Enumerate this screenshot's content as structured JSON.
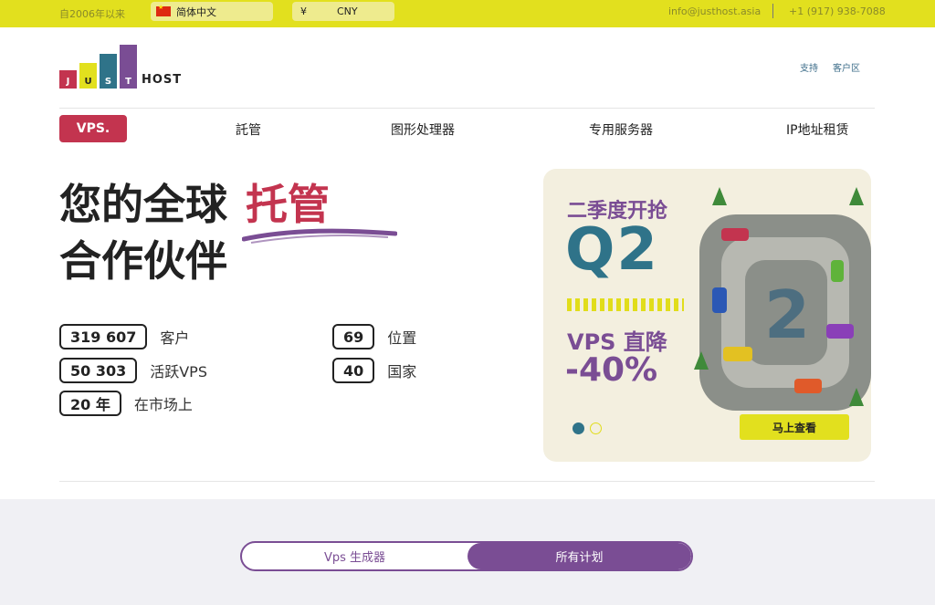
{
  "topbar": {
    "since": "自2006年以来",
    "language": "简体中文",
    "currency_symbol": "¥",
    "currency": "CNY",
    "email": "info@justhost.asia",
    "phone": "+1 (917) 938-7088",
    "background_color": "#e2e01e"
  },
  "logo": {
    "letters": [
      "J",
      "U",
      "S",
      "T"
    ],
    "text": "HOST",
    "bar_colors": [
      "#c3344f",
      "#e2e01e",
      "#2f7389",
      "#7a4d94"
    ]
  },
  "header_links": {
    "support": "支持",
    "client_area": "客户区"
  },
  "nav": {
    "active": "VPS.",
    "items": [
      "託管",
      "图形处理器",
      "专用服务器",
      "IP地址租赁"
    ]
  },
  "hero": {
    "title_line1": "您的全球",
    "title_highlight": "托管",
    "title_line2": "合作伙伴",
    "stats": [
      {
        "value": "319 607",
        "label": "客户"
      },
      {
        "value": "50 303",
        "label": "活跃VPS"
      },
      {
        "value": "20 年",
        "label": "在市场上"
      },
      {
        "value": "69",
        "label": "位置"
      },
      {
        "value": "40",
        "label": "国家"
      }
    ]
  },
  "banner": {
    "kicker": "二季度开抢",
    "headline": "Q2",
    "line1": "VPS 直降",
    "line2": "-40%",
    "cta": "马上查看",
    "art_number": "2",
    "slides": 2,
    "active_slide": 1
  },
  "plans_toggle": {
    "left": "Vps 生成器",
    "right": "所有计划",
    "selected": "right"
  },
  "colors": {
    "accent_red": "#c3344f",
    "accent_purple": "#7a4d94",
    "accent_teal": "#2f7389",
    "accent_yellow": "#e2e01e"
  }
}
